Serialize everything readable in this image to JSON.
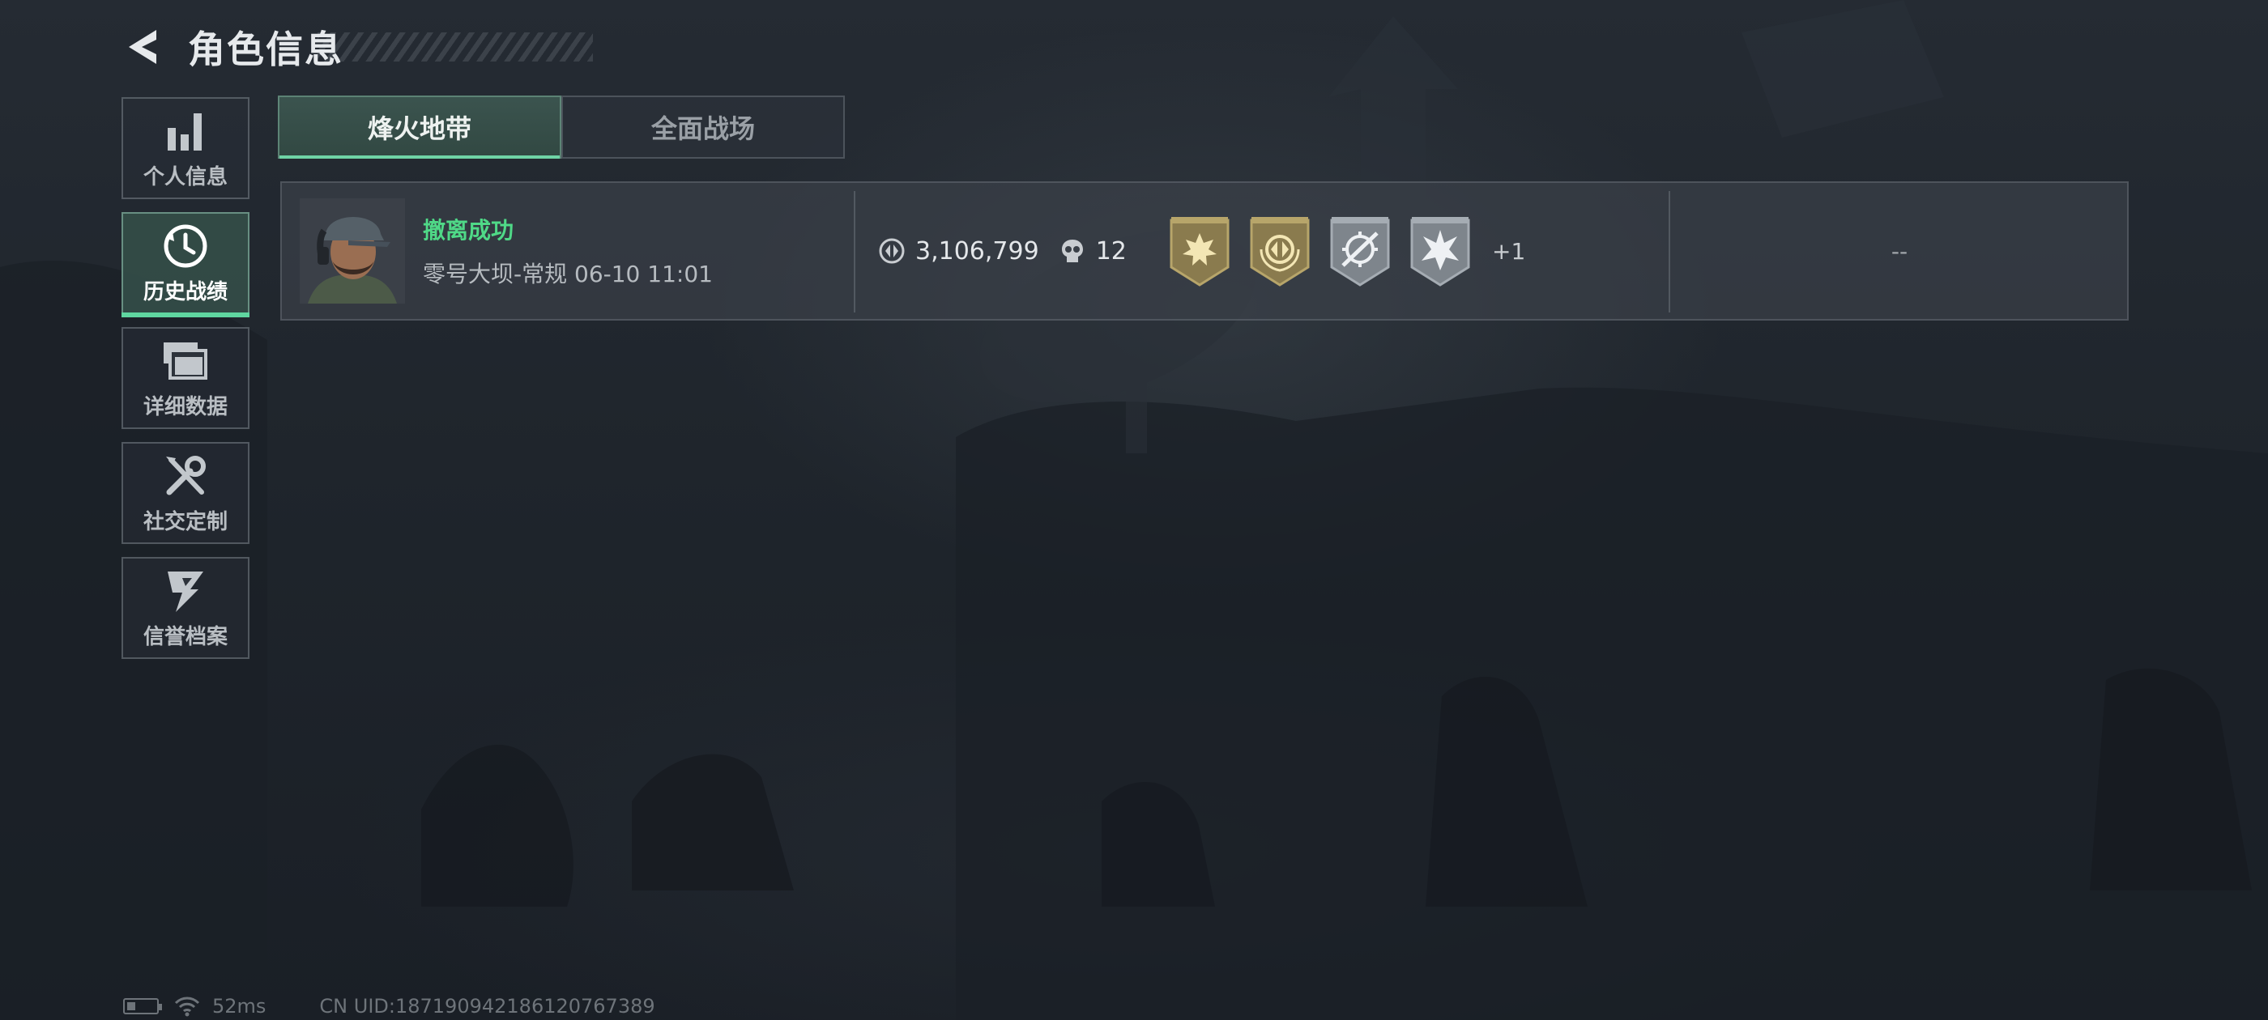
{
  "header": {
    "title": "角色信息"
  },
  "sidebar": {
    "items": [
      {
        "label": "个人信息",
        "icon": "bar-chart-icon",
        "active": false
      },
      {
        "label": "历史战绩",
        "icon": "history-clock-icon",
        "active": true
      },
      {
        "label": "详细数据",
        "icon": "stacked-folders-icon",
        "active": false
      },
      {
        "label": "社交定制",
        "icon": "wrench-screwdriver-icon",
        "active": false
      },
      {
        "label": "信誉档案",
        "icon": "lightning-shield-icon",
        "active": false
      }
    ]
  },
  "tabs": [
    {
      "label": "烽火地带",
      "active": true
    },
    {
      "label": "全面战场",
      "active": false
    }
  ],
  "record": {
    "status": "撤离成功",
    "detail": "零号大坝-常规 06-10 11:01",
    "currency_value": "3,106,799",
    "kills": "12",
    "badges": [
      {
        "icon": "gold-sunburst-badge-icon",
        "color": "#9a8a5a"
      },
      {
        "icon": "gold-crest-badge-icon",
        "color": "#9a8a5a"
      },
      {
        "icon": "silver-crosshair-badge-icon",
        "color": "#8a9096"
      },
      {
        "icon": "silver-burst-badge-icon",
        "color": "#8a9096"
      }
    ],
    "badges_more": "+1",
    "right_value": "--"
  },
  "statusbar": {
    "ping": "52ms",
    "uid": "CN UID:18719094218612076​7389"
  },
  "colors": {
    "accent": "#5fd6a0",
    "success": "#4fd987"
  }
}
